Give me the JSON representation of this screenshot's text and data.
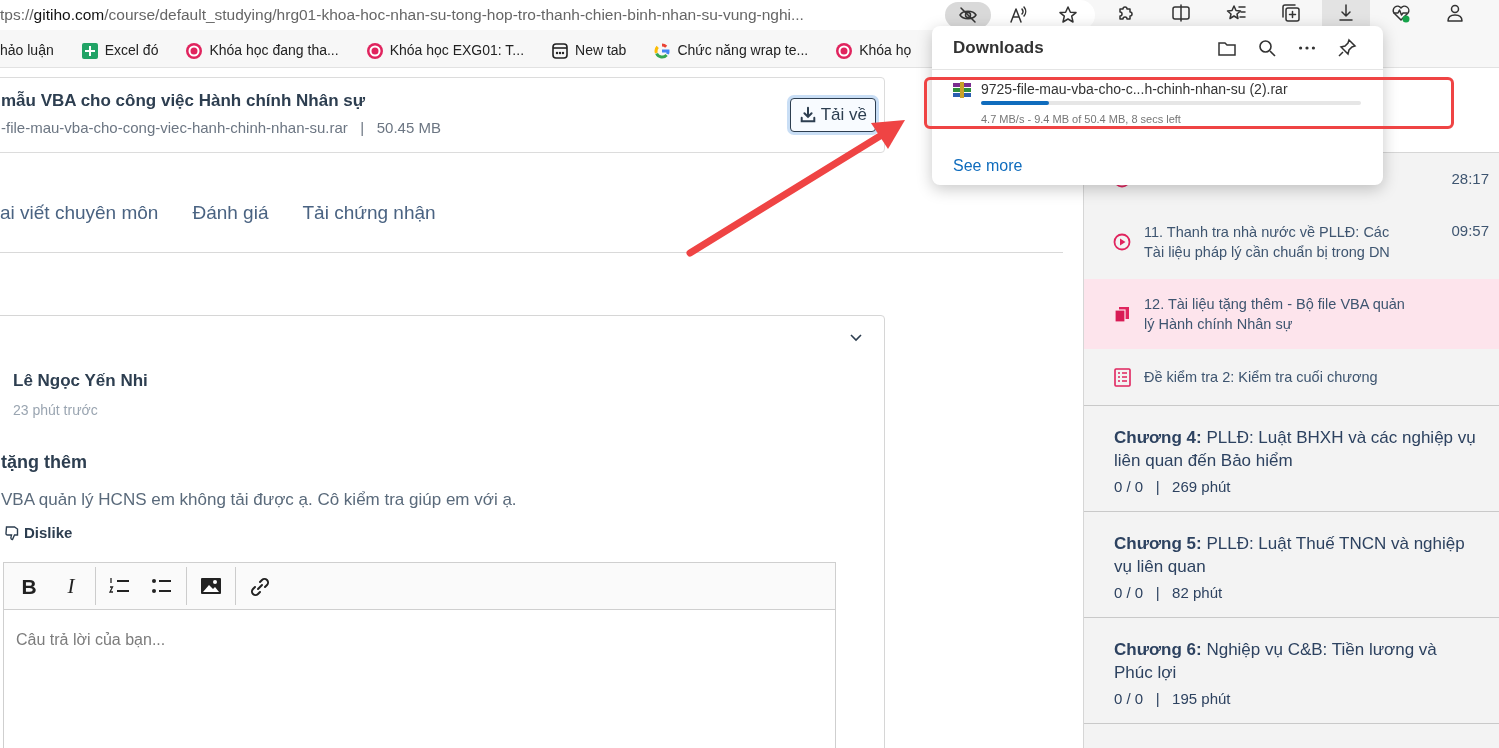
{
  "browser": {
    "address": {
      "scheme": "tps://",
      "host": "gitiho.com",
      "path": "/course/default_studying/hrg01-khoa-hoc-nhan-su-tong-hop-tro-thanh-chien-binh-nhan-su-vung-nghi..."
    },
    "address_icons": [
      {
        "kind": "tracking",
        "active": true
      },
      {
        "kind": "read-aloud",
        "active": false
      },
      {
        "kind": "favorite",
        "active": false
      }
    ],
    "toolbar_icons": [
      {
        "kind": "extensions",
        "active": false
      },
      {
        "kind": "split",
        "active": false
      },
      {
        "kind": "favorites",
        "active": false
      },
      {
        "kind": "collections",
        "active": false
      },
      {
        "kind": "downloads",
        "active": true
      },
      {
        "kind": "health",
        "active": false
      },
      {
        "kind": "profile",
        "active": false
      }
    ],
    "bookmarks": [
      {
        "kind": "none",
        "label": "hảo luận"
      },
      {
        "kind": "sheet",
        "label": "Excel đó"
      },
      {
        "kind": "gitiho",
        "label": "Khóa học đang tha..."
      },
      {
        "kind": "gitiho",
        "label": "Khóa học EXG01: T..."
      },
      {
        "kind": "newtab",
        "label": "New tab"
      },
      {
        "kind": "google",
        "label": "Chức năng wrap te..."
      },
      {
        "kind": "gitiho",
        "label": "Khóa họ"
      }
    ]
  },
  "downloads": {
    "title": "Downloads",
    "items": [
      {
        "name": "9725-file-mau-vba-cho-c...h-chinh-nhan-su (2).rar",
        "level": 0.18,
        "status": "4.7 MB/s - 9.4 MB of 50.4 MB, 8 secs left"
      }
    ],
    "see_more": "See more"
  },
  "file": {
    "title": "mẫu VBA cho công việc Hành chính Nhân sự",
    "meta": "-file-mau-vba-cho-cong-viec-hanh-chinh-nhan-su.rar   |   50.45 MB",
    "button": "Tải về"
  },
  "tabs": [
    {
      "label": "ai viết chuyên môn",
      "selected": false
    },
    {
      "label": "Đánh giá",
      "selected": false
    },
    {
      "label": "Tải chứng nhận",
      "selected": false
    }
  ],
  "comment": {
    "author": "Lê Ngọc Yến Nhi",
    "time": "23 phút trước",
    "title": "tặng thêm",
    "body": "VBA quản lý HCNS em không tải được ạ. Cô kiểm tra giúp em với ạ.",
    "dislike": "Dislike"
  },
  "editor": {
    "toolbar_groups": [
      [
        {
          "kind": "bold",
          "label": "B"
        },
        {
          "kind": "italic",
          "label": "I"
        }
      ],
      [
        {
          "kind": "ordered-list"
        },
        {
          "kind": "bullet-list"
        }
      ],
      [
        {
          "kind": "image"
        }
      ],
      [
        {
          "kind": "link"
        }
      ]
    ],
    "placeholder": "Câu trả lời của bạn..."
  },
  "sidebar": {
    "lessons": [
      {
        "kind": "video",
        "selected": false,
        "duration": "28:17"
      },
      {
        "kind": "video",
        "selected": false,
        "title": "11. Thanh tra nhà nước về PLLĐ: Các Tài liệu pháp lý cần chuẩn bị trong DN",
        "duration": "09:57"
      },
      {
        "kind": "document",
        "selected": true,
        "title": "12. Tài liệu tặng thêm - Bộ file VBA quản lý Hành chính Nhân sự"
      },
      {
        "kind": "quiz",
        "selected": false,
        "title": "Đề kiểm tra 2: Kiểm tra cuối chương"
      }
    ],
    "chapters": [
      {
        "title": "**Chương 4:** PLLĐ: Luật BHXH và các nghiệp vụ liên quan đến Bảo hiểm",
        "meta": "0 / 0   |   269 phút"
      },
      {
        "title": "**Chương 5:** PLLĐ: Luật Thuế TNCN và nghiệp vụ liên quan",
        "meta": "0 / 0   |   82 phút"
      },
      {
        "title": "**Chương 6:** Nghiệp vụ C&B: Tiền lương và Phúc lợi",
        "meta": "0 / 0   |   195 phút"
      }
    ]
  },
  "annotations": {
    "highlight_box": true,
    "arrow": true
  }
}
